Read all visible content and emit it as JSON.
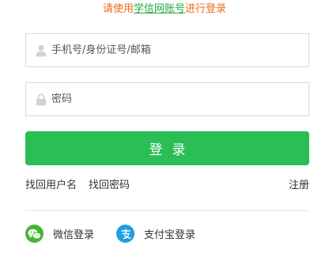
{
  "hint": {
    "prefix": "请使用",
    "link": "学信网账号",
    "suffix": "进行登录",
    "prefix_color": "#f06a1b",
    "link_color": "#22a83e"
  },
  "form": {
    "username_placeholder": "手机号/身份证号/邮箱",
    "username_value": "",
    "password_placeholder": "密码",
    "password_value": "",
    "login_label": "登录",
    "login_color": "#2bbd56"
  },
  "links": {
    "retrieve_username": "找回用户名",
    "retrieve_password": "找回密码",
    "register": "注册"
  },
  "third_party": {
    "wechat_label": "微信登录",
    "alipay_label": "支付宝登录",
    "wechat_color": "#43b734",
    "alipay_color": "#1e9fe0"
  },
  "icons": {
    "user": "user-icon",
    "lock": "lock-icon",
    "wechat": "wechat-icon",
    "alipay": "alipay-icon"
  }
}
